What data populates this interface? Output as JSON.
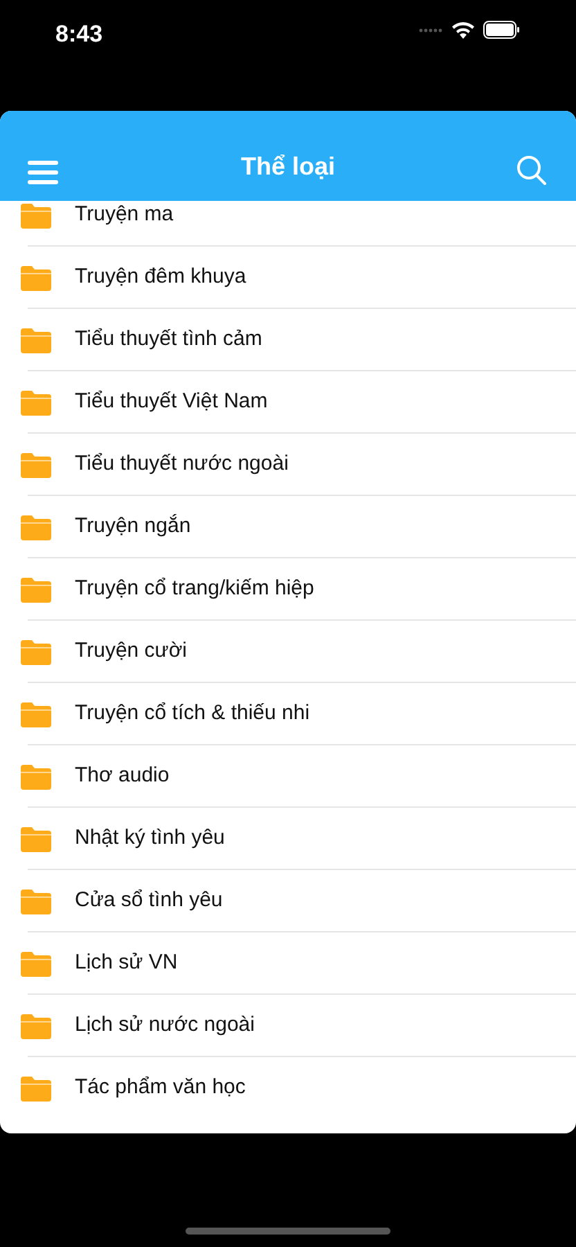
{
  "status_bar": {
    "time": "8:43"
  },
  "header": {
    "title": "Thể loại"
  },
  "categories": [
    {
      "label": "Truyện ma"
    },
    {
      "label": "Truyện đêm khuya"
    },
    {
      "label": "Tiểu thuyết tình cảm"
    },
    {
      "label": "Tiểu thuyết Việt Nam"
    },
    {
      "label": "Tiểu thuyết nước ngoài"
    },
    {
      "label": "Truyện ngắn"
    },
    {
      "label": "Truyện cổ trang/kiếm hiệp"
    },
    {
      "label": "Truyện cười"
    },
    {
      "label": "Truyện cổ tích & thiếu nhi"
    },
    {
      "label": "Thơ audio"
    },
    {
      "label": "Nhật ký tình yêu"
    },
    {
      "label": "Cửa sổ tình yêu"
    },
    {
      "label": "Lịch sử VN"
    },
    {
      "label": "Lịch sử nước ngoài"
    },
    {
      "label": "Tác phẩm văn học"
    }
  ]
}
